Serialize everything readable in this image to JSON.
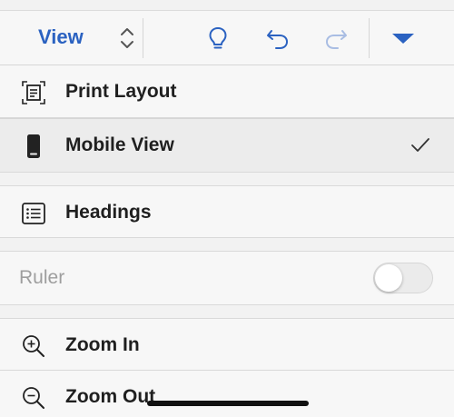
{
  "toolbar": {
    "title": "View",
    "stepper_icon": "chevron-up-down-icon",
    "buttons": [
      {
        "name": "lightbulb-icon"
      },
      {
        "name": "undo-icon"
      },
      {
        "name": "redo-icon"
      },
      {
        "name": "dropdown-triangle-icon"
      }
    ],
    "accent": "#2b62c1"
  },
  "menu": {
    "print_layout": {
      "label": "Print Layout",
      "icon": "print-layout-icon"
    },
    "mobile_view": {
      "label": "Mobile View",
      "icon": "phone-icon",
      "checked": true
    },
    "headings": {
      "label": "Headings",
      "icon": "list-icon"
    },
    "ruler": {
      "label": "Ruler",
      "enabled": false,
      "toggle_on": false
    },
    "zoom_in": {
      "label": "Zoom In",
      "icon": "zoom-in-icon"
    },
    "zoom_out": {
      "label": "Zoom Out",
      "icon": "zoom-out-icon"
    }
  }
}
